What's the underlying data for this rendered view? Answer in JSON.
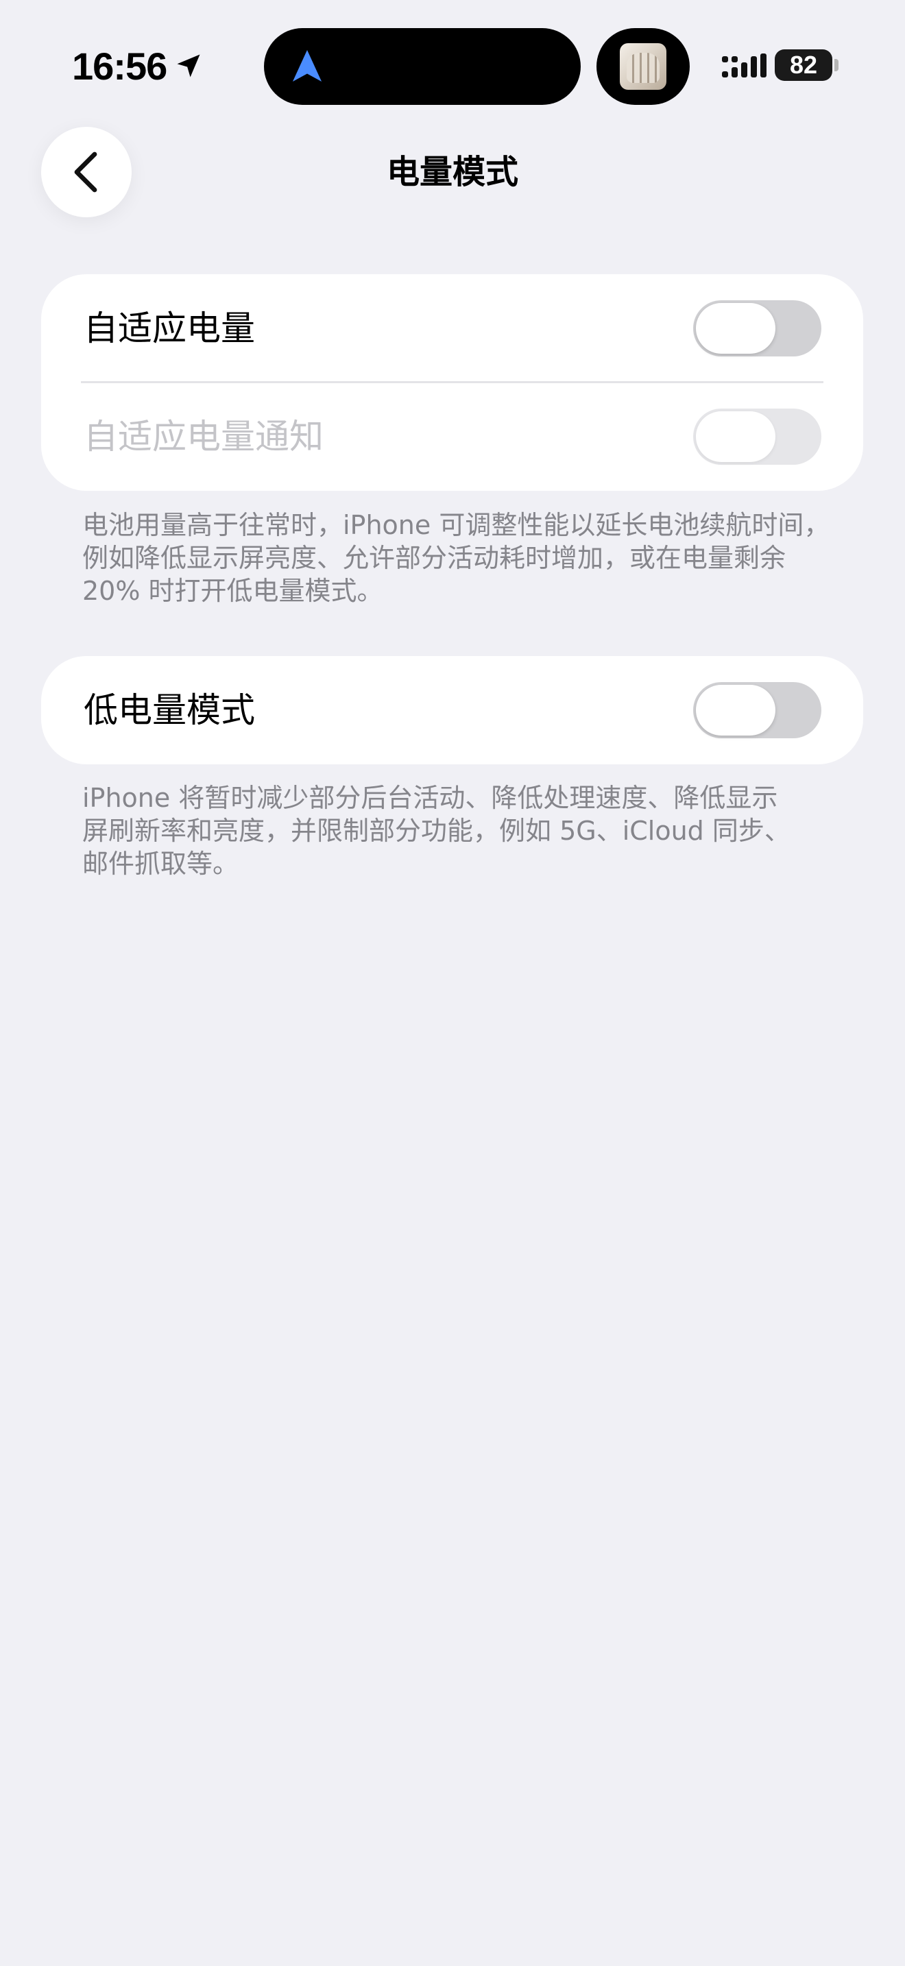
{
  "status_bar": {
    "time": "16:56",
    "battery_level": "82",
    "icons": [
      "location-arrow-icon",
      "navigation-icon",
      "album-art",
      "signal-icon",
      "battery-icon"
    ]
  },
  "nav": {
    "title": "电量模式",
    "back_icon": "chevron-left-icon"
  },
  "adaptive_group": {
    "rows": [
      {
        "label": "自适应电量",
        "toggle_on": false,
        "enabled": true
      },
      {
        "label": "自适应电量通知",
        "toggle_on": false,
        "enabled": false
      }
    ],
    "footer_lines": [
      "电池用量高于往常时，iPhone 可调整性能以延长电池续航时间，",
      "例如降低显示屏亮度、允许部分活动耗时增加，或在电量剩余",
      "20% 时打开低电量模式。"
    ]
  },
  "low_power_group": {
    "rows": [
      {
        "label": "低电量模式",
        "toggle_on": false,
        "enabled": true
      }
    ],
    "footer_lines": [
      "iPhone 将暂时减少部分后台活动、降低处理速度、降低显示",
      "屏刷新率和亮度，并限制部分功能，例如 5G、iCloud 同步、",
      "邮件抓取等。"
    ]
  },
  "colors": {
    "background": "#F0F0F5",
    "card": "#FFFFFF",
    "toggle_off": "#D1D1D4",
    "toggle_disabled": "#E6E6E9",
    "footer_text": "#85858B",
    "disabled_text": "#C4C4C8",
    "nav_accent": "#4A8CFF"
  }
}
